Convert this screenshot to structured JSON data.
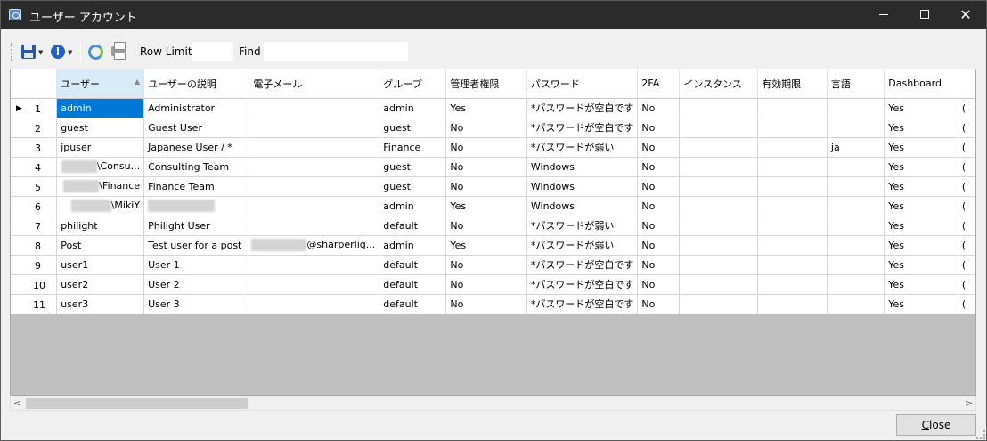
{
  "window": {
    "title": "ユーザー アカウント"
  },
  "toolbar": {
    "row_limit_label": "Row Limit",
    "row_limit_value": "",
    "find_label": "Find",
    "find_value": ""
  },
  "columns": [
    "",
    "ユーザー",
    "ユーザーの説明",
    "電子メール",
    "グループ",
    "管理者権限",
    "パスワード",
    "2FA",
    "インスタンス",
    "有効期限",
    "言語",
    "Dashboard",
    ""
  ],
  "rows": [
    [
      "1",
      "admin",
      "Administrator",
      "",
      "admin",
      "Yes",
      "*パスワードが空白です",
      "No",
      "",
      "",
      "",
      "Yes",
      "("
    ],
    [
      "2",
      "guest",
      "Guest User",
      "",
      "guest",
      "No",
      "*パスワードが空白です",
      "No",
      "",
      "",
      "",
      "Yes",
      "("
    ],
    [
      "3",
      "jpuser",
      "Japanese User / *",
      "",
      "Finance",
      "No",
      "*パスワードが弱い",
      "No",
      "",
      "",
      "ja",
      "Yes",
      "("
    ],
    [
      "4",
      "\\Consu...",
      "Consulting Team",
      "",
      "guest",
      "No",
      "Windows",
      "No",
      "",
      "",
      "",
      "Yes",
      "("
    ],
    [
      "5",
      "\\Finance",
      "Finance Team",
      "",
      "guest",
      "No",
      "Windows",
      "No",
      "",
      "",
      "",
      "Yes",
      "("
    ],
    [
      "6",
      "\\MikiY",
      "",
      "",
      "admin",
      "Yes",
      "Windows",
      "No",
      "",
      "",
      "",
      "Yes",
      "("
    ],
    [
      "7",
      "philight",
      "Philight User",
      "",
      "default",
      "No",
      "*パスワードが弱い",
      "No",
      "",
      "",
      "",
      "Yes",
      "("
    ],
    [
      "8",
      "Post",
      "Test user for a post",
      "@sharperlig...",
      "admin",
      "Yes",
      "*パスワードが弱い",
      "No",
      "",
      "",
      "",
      "Yes",
      "("
    ],
    [
      "9",
      "user1",
      "User 1",
      "",
      "default",
      "No",
      "*パスワードが空白です",
      "No",
      "",
      "",
      "",
      "Yes",
      "("
    ],
    [
      "10",
      "user2",
      "User 2",
      "",
      "default",
      "No",
      "*パスワードが空白です",
      "No",
      "",
      "",
      "",
      "Yes",
      "("
    ],
    [
      "11",
      "user3",
      "User 3",
      "",
      "default",
      "No",
      "*パスワードが空白です",
      "No",
      "",
      "",
      "",
      "Yes",
      "("
    ]
  ],
  "close_button": {
    "label_underlined": "C",
    "label_rest": "lose"
  },
  "colors": {
    "titlebar": "#2b2b2b",
    "selection": "#0078d7",
    "sorted_header": "#d9ebf9"
  }
}
